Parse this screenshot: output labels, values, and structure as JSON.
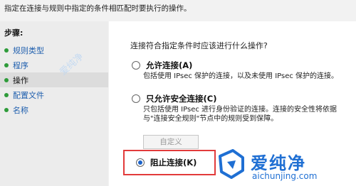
{
  "top_description": "指定在连接与规则中指定的条件相匹配时要执行的操作。",
  "steps": {
    "title": "步骤:",
    "items": [
      {
        "label": "规则类型"
      },
      {
        "label": "程序"
      },
      {
        "label": "操作"
      },
      {
        "label": "配置文件"
      },
      {
        "label": "名称"
      }
    ]
  },
  "panel": {
    "question": "连接符合指定条件时应该进行什么操作?",
    "options": [
      {
        "label": "允许连接(A)",
        "desc": [
          "包括使用 IPsec 保护的连接，以及未使用 IPsec 保护的连接。"
        ]
      },
      {
        "label": "只允许安全连接(C)",
        "desc": [
          "只包括使用 IPsec 进行身份验证的连接。连接的安全性将依据",
          "与\"连接安全规则\"节点中的规则受到保障。"
        ]
      },
      {
        "label": "阻止连接(K)",
        "desc": []
      }
    ],
    "custom_button": "自定义"
  },
  "watermark": {
    "faint": "爱纯净",
    "brand": "爱纯净",
    "url": "aichunjing.com"
  }
}
